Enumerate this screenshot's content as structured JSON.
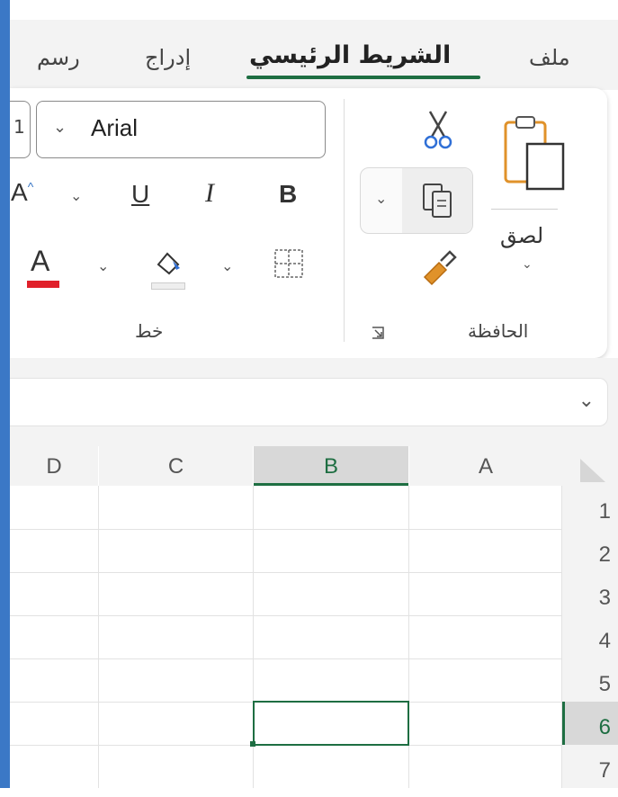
{
  "tabs": [
    {
      "label": "ملف",
      "active": false
    },
    {
      "label": "الشريط الرئيسي",
      "active": true
    },
    {
      "label": "إدراج",
      "active": false
    },
    {
      "label": "رسم",
      "active": false
    }
  ],
  "clipboard": {
    "paste_label": "لصق",
    "group_label": "الحافظة"
  },
  "font": {
    "font_name": "Arial",
    "font_size_partial": "1",
    "bold_label": "B",
    "italic_label": "I",
    "underline_label": "U",
    "grow_label": "A",
    "font_color_label": "A",
    "group_label": "خط"
  },
  "colors": {
    "accent": "#1e6e42",
    "font_color": "#e0202a",
    "window_frame": "#3b78c6"
  },
  "grid": {
    "columns": [
      "D",
      "C",
      "B",
      "A"
    ],
    "rows": [
      "1",
      "2",
      "3",
      "4",
      "5",
      "6",
      "7"
    ],
    "selected_column": "B",
    "selected_row": "6"
  }
}
